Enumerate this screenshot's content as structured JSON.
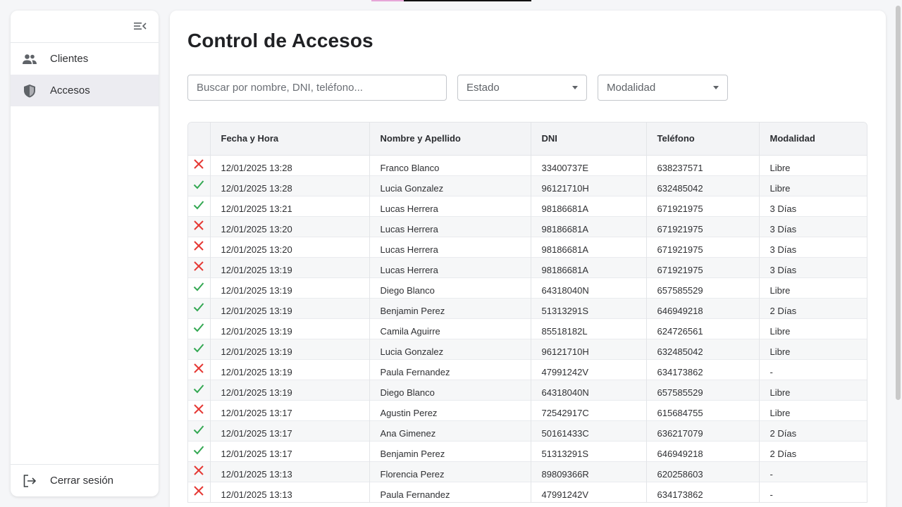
{
  "sidebar": {
    "items": [
      {
        "label": "Clientes",
        "icon": "people-icon",
        "active": false
      },
      {
        "label": "Accesos",
        "icon": "shield-icon",
        "active": true
      }
    ],
    "logout_label": "Cerrar sesión",
    "logout_icon": "logout-icon"
  },
  "main": {
    "title": "Control de Accesos",
    "search": {
      "placeholder": "Buscar por nombre, DNI, teléfono...",
      "value": ""
    },
    "filters": {
      "estado": "Estado",
      "modalidad": "Modalidad"
    },
    "table": {
      "columns": [
        "",
        "Fecha y Hora",
        "Nombre y Apellido",
        "DNI",
        "Teléfono",
        "Modalidad"
      ],
      "rows": [
        {
          "status": "denied",
          "datetime": "12/01/2025 13:28",
          "name": "Franco Blanco",
          "dni": "33400737E",
          "phone": "638237571",
          "modality": "Libre"
        },
        {
          "status": "granted",
          "datetime": "12/01/2025 13:28",
          "name": "Lucia Gonzalez",
          "dni": "96121710H",
          "phone": "632485042",
          "modality": "Libre"
        },
        {
          "status": "granted",
          "datetime": "12/01/2025 13:21",
          "name": "Lucas Herrera",
          "dni": "98186681A",
          "phone": "671921975",
          "modality": "3 Días"
        },
        {
          "status": "denied",
          "datetime": "12/01/2025 13:20",
          "name": "Lucas Herrera",
          "dni": "98186681A",
          "phone": "671921975",
          "modality": "3 Días"
        },
        {
          "status": "denied",
          "datetime": "12/01/2025 13:20",
          "name": "Lucas Herrera",
          "dni": "98186681A",
          "phone": "671921975",
          "modality": "3 Días"
        },
        {
          "status": "denied",
          "datetime": "12/01/2025 13:19",
          "name": "Lucas Herrera",
          "dni": "98186681A",
          "phone": "671921975",
          "modality": "3 Días"
        },
        {
          "status": "granted",
          "datetime": "12/01/2025 13:19",
          "name": "Diego Blanco",
          "dni": "64318040N",
          "phone": "657585529",
          "modality": "Libre"
        },
        {
          "status": "granted",
          "datetime": "12/01/2025 13:19",
          "name": "Benjamin Perez",
          "dni": "51313291S",
          "phone": "646949218",
          "modality": "2 Días"
        },
        {
          "status": "granted",
          "datetime": "12/01/2025 13:19",
          "name": "Camila Aguirre",
          "dni": "85518182L",
          "phone": "624726561",
          "modality": "Libre"
        },
        {
          "status": "granted",
          "datetime": "12/01/2025 13:19",
          "name": "Lucia Gonzalez",
          "dni": "96121710H",
          "phone": "632485042",
          "modality": "Libre"
        },
        {
          "status": "denied",
          "datetime": "12/01/2025 13:19",
          "name": "Paula Fernandez",
          "dni": "47991242V",
          "phone": "634173862",
          "modality": "-"
        },
        {
          "status": "granted",
          "datetime": "12/01/2025 13:19",
          "name": "Diego Blanco",
          "dni": "64318040N",
          "phone": "657585529",
          "modality": "Libre"
        },
        {
          "status": "denied",
          "datetime": "12/01/2025 13:17",
          "name": "Agustin Perez",
          "dni": "72542917C",
          "phone": "615684755",
          "modality": "Libre"
        },
        {
          "status": "granted",
          "datetime": "12/01/2025 13:17",
          "name": "Ana Gimenez",
          "dni": "50161433C",
          "phone": "636217079",
          "modality": "2 Días"
        },
        {
          "status": "granted",
          "datetime": "12/01/2025 13:17",
          "name": "Benjamin Perez",
          "dni": "51313291S",
          "phone": "646949218",
          "modality": "2 Días"
        },
        {
          "status": "denied",
          "datetime": "12/01/2025 13:13",
          "name": "Florencia Perez",
          "dni": "89809366R",
          "phone": "620258603",
          "modality": "-"
        },
        {
          "status": "denied",
          "datetime": "12/01/2025 13:13",
          "name": "Paula Fernandez",
          "dni": "47991242V",
          "phone": "634173862",
          "modality": "-"
        }
      ]
    }
  },
  "colors": {
    "granted": "#34a853",
    "denied": "#e53935",
    "active_nav_bg": "#ececf1",
    "header_bg": "#f3f4f6"
  }
}
